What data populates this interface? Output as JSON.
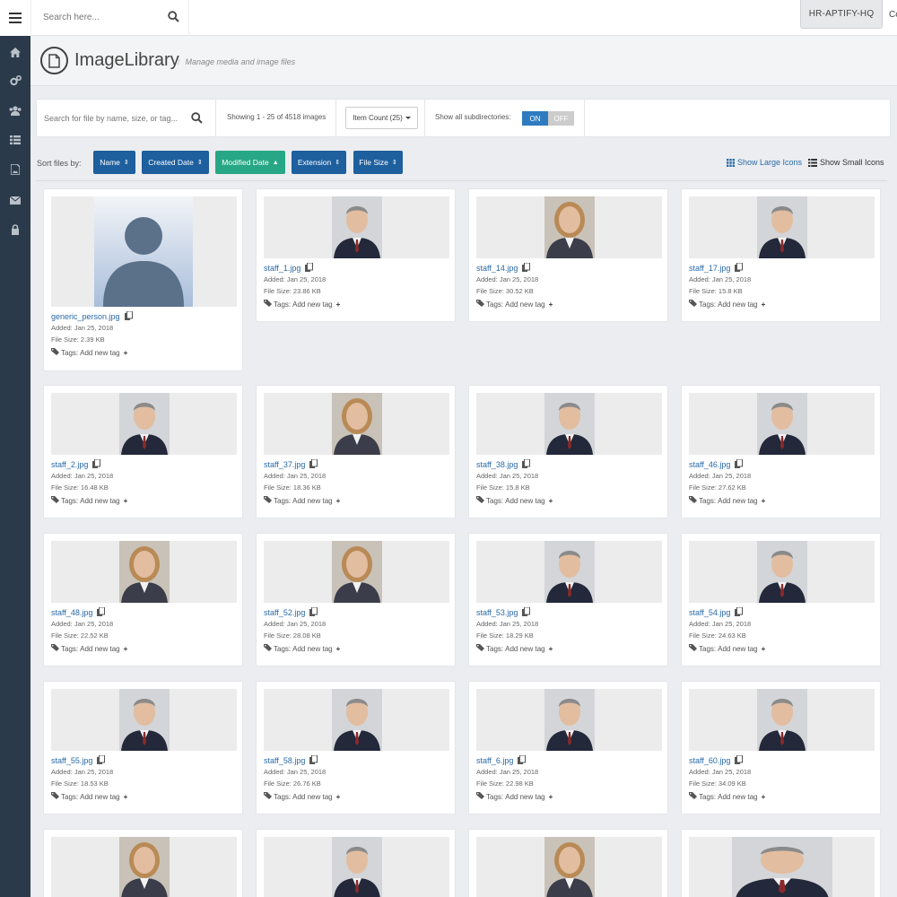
{
  "topbar": {
    "search_placeholder": "Search here...",
    "org_button": "HR-APTIFY-HQ",
    "cut_text": "Co"
  },
  "sidebar": {
    "items": [
      {
        "icon": "home-icon"
      },
      {
        "icon": "gears-icon"
      },
      {
        "icon": "users-icon"
      },
      {
        "icon": "list-icon"
      },
      {
        "icon": "image-file-icon"
      },
      {
        "icon": "envelope-icon"
      },
      {
        "icon": "lock-icon"
      }
    ]
  },
  "header": {
    "title": "ImageLibrary",
    "separator": "/",
    "subtitle": "Manage media and image files"
  },
  "filters": {
    "search_placeholder": "Search for file by name, size, or tag...",
    "showing": "Showing 1 - 25 of 4518 images",
    "item_count": "Item Count (25)",
    "subdir_label": "Show all subdirectories:",
    "toggle_on": "ON",
    "toggle_off": "OFF"
  },
  "sort": {
    "label": "Sort files by:",
    "buttons": [
      {
        "label": "Name",
        "arrow": "⇕"
      },
      {
        "label": "Created Date",
        "arrow": "⇕"
      },
      {
        "label": "Modified Date",
        "arrow": "▲"
      },
      {
        "label": "Extension",
        "arrow": "⇕"
      },
      {
        "label": "File Size",
        "arrow": "⇕"
      }
    ],
    "view_large": "Show Large Icons",
    "view_small": "Show Small Icons"
  },
  "tags_label": "Tags:",
  "add_tag": "Add new tag",
  "files": [
    {
      "name": "generic_person.jpg",
      "added": "Added: Jan 25, 2018",
      "size": "File Size: 2.39 KB",
      "thumb": "generic"
    },
    {
      "name": "staff_1.jpg",
      "added": "Added: Jan 25, 2018",
      "size": "File Size: 23.86 KB",
      "thumb": "man"
    },
    {
      "name": "staff_14.jpg",
      "added": "Added: Jan 25, 2018",
      "size": "File Size: 30.52 KB",
      "thumb": "woman"
    },
    {
      "name": "staff_17.jpg",
      "added": "Added: Jan 25, 2018",
      "size": "File Size: 15.8 KB",
      "thumb": "man"
    },
    {
      "name": "staff_2.jpg",
      "added": "Added: Jan 25, 2018",
      "size": "File Size: 16.48 KB",
      "thumb": "man"
    },
    {
      "name": "staff_37.jpg",
      "added": "Added: Jan 25, 2018",
      "size": "File Size: 18.36 KB",
      "thumb": "woman"
    },
    {
      "name": "staff_38.jpg",
      "added": "Added: Jan 25, 2018",
      "size": "File Size: 15.8 KB",
      "thumb": "man"
    },
    {
      "name": "staff_46.jpg",
      "added": "Added: Jan 25, 2018",
      "size": "File Size: 27.62 KB",
      "thumb": "man"
    },
    {
      "name": "staff_48.jpg",
      "added": "Added: Jan 25, 2018",
      "size": "File Size: 22.52 KB",
      "thumb": "woman"
    },
    {
      "name": "staff_52.jpg",
      "added": "Added: Jan 25, 2018",
      "size": "File Size: 28.08 KB",
      "thumb": "woman"
    },
    {
      "name": "staff_53.jpg",
      "added": "Added: Jan 25, 2018",
      "size": "File Size: 18.29 KB",
      "thumb": "man"
    },
    {
      "name": "staff_54.jpg",
      "added": "Added: Jan 25, 2018",
      "size": "File Size: 24.63 KB",
      "thumb": "man"
    },
    {
      "name": "staff_55.jpg",
      "added": "Added: Jan 25, 2018",
      "size": "File Size: 18.53 KB",
      "thumb": "man"
    },
    {
      "name": "staff_58.jpg",
      "added": "Added: Jan 25, 2018",
      "size": "File Size: 26.76 KB",
      "thumb": "man"
    },
    {
      "name": "staff_6.jpg",
      "added": "Added: Jan 25, 2018",
      "size": "File Size: 22.98 KB",
      "thumb": "man"
    },
    {
      "name": "staff_60.jpg",
      "added": "Added: Jan 25, 2018",
      "size": "File Size: 34.09 KB",
      "thumb": "man"
    },
    {
      "thumb": "woman"
    },
    {
      "thumb": "man"
    },
    {
      "thumb": "woman"
    },
    {
      "thumb": "man"
    }
  ]
}
